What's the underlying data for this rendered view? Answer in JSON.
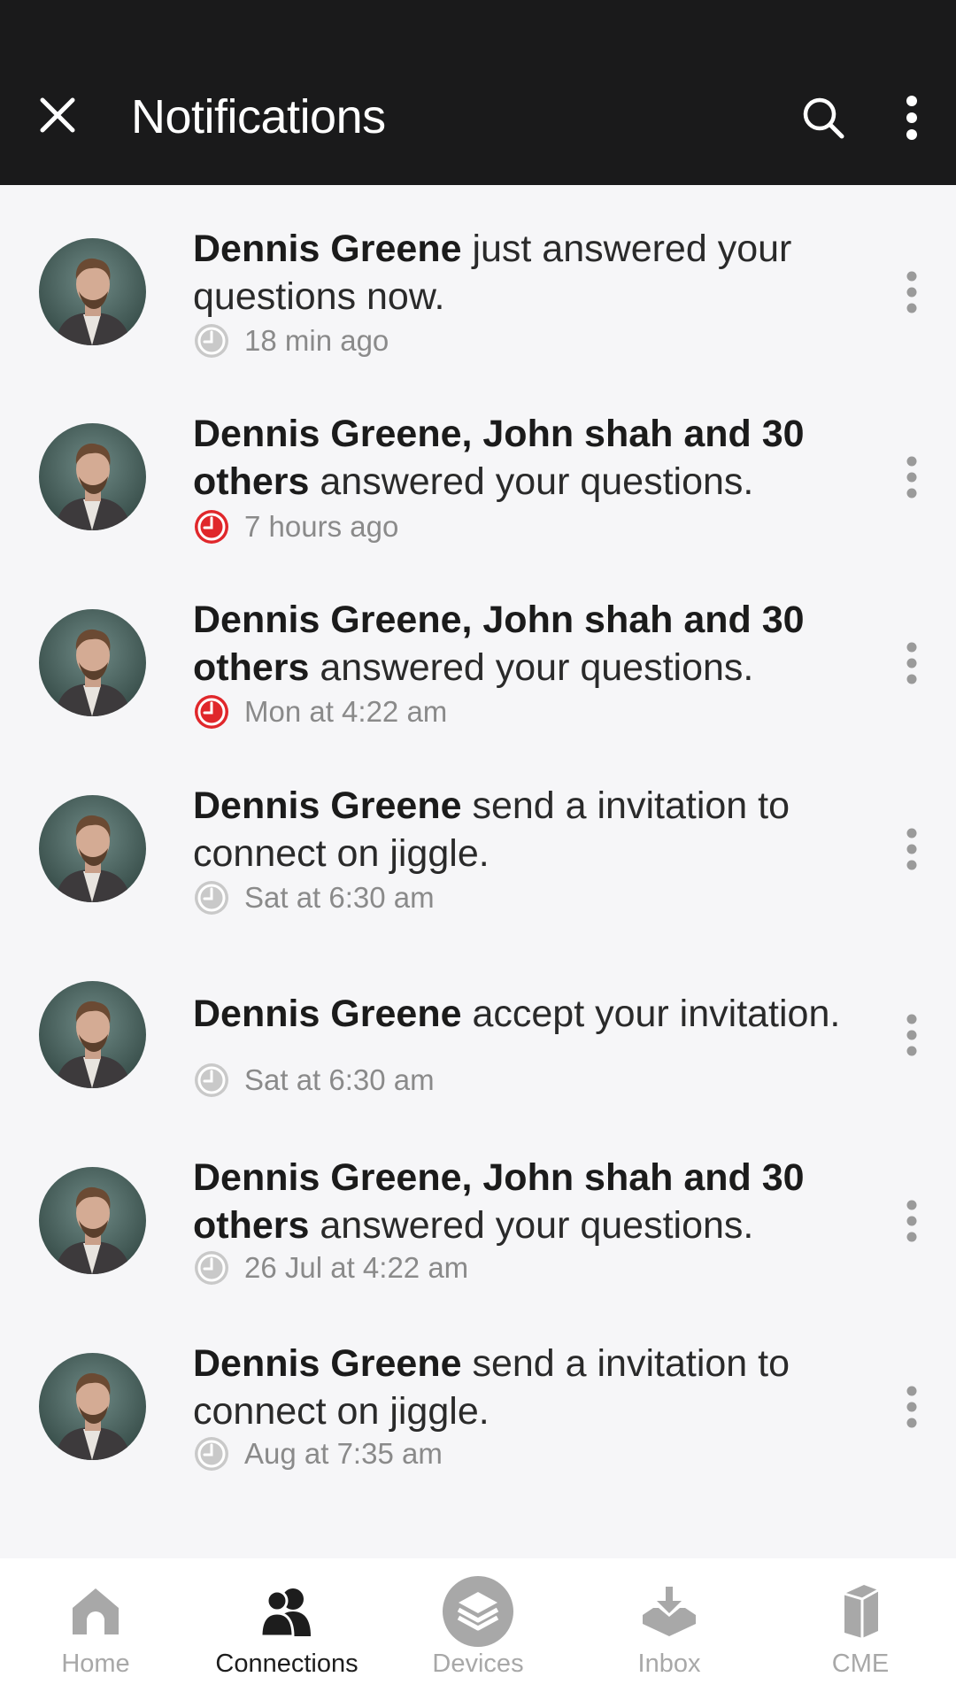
{
  "app_bar": {
    "title": "Notifications",
    "close_icon": "close-icon",
    "search_icon": "search-icon",
    "more_icon": "more-vert-icon",
    "background": "#1a1a1b"
  },
  "notifications": [
    {
      "bold": "Dennis Greene",
      "rest": " just answered your questions now.",
      "time": "18 min ago",
      "clock_color": "#c9c9c9"
    },
    {
      "bold": "Dennis Greene, John shah and 30 others",
      "rest": " answered your questions.",
      "time": "7 hours ago",
      "clock_color": "#e0272b"
    },
    {
      "bold": "Dennis Greene, John shah and 30 others",
      "rest": " answered your questions.",
      "time": "Mon at 4:22 am",
      "clock_color": "#e0272b"
    },
    {
      "bold": "Dennis Greene",
      "rest": " send a invitation to connect on jiggle.",
      "time": "Sat at 6:30 am",
      "clock_color": "#c9c9c9"
    },
    {
      "bold": "Dennis Greene",
      "rest": " accept your invitation.",
      "time": "Sat at 6:30 am",
      "clock_color": "#c9c9c9"
    },
    {
      "bold": "Dennis Greene, John shah and 30 others",
      "rest": " answered your questions.",
      "time": "26 Jul at 4:22 am",
      "clock_color": "#c9c9c9"
    },
    {
      "bold": "Dennis Greene",
      "rest": " send a invitation to connect on jiggle.",
      "time": "Aug at 7:35 am",
      "clock_color": "#c9c9c9"
    }
  ],
  "bottom_nav": {
    "items": [
      {
        "label": "Home",
        "icon": "home-icon",
        "active": false
      },
      {
        "label": "Connections",
        "icon": "connections-icon",
        "active": true
      },
      {
        "label": "Devices",
        "icon": "devices-icon",
        "active": false
      },
      {
        "label": "Inbox",
        "icon": "inbox-icon",
        "active": false
      },
      {
        "label": "CME",
        "icon": "cme-icon",
        "active": false
      }
    ]
  },
  "colors": {
    "accent_red": "#e0272b",
    "muted_gray": "#a8a8a8",
    "background": "#f6f6f8"
  }
}
